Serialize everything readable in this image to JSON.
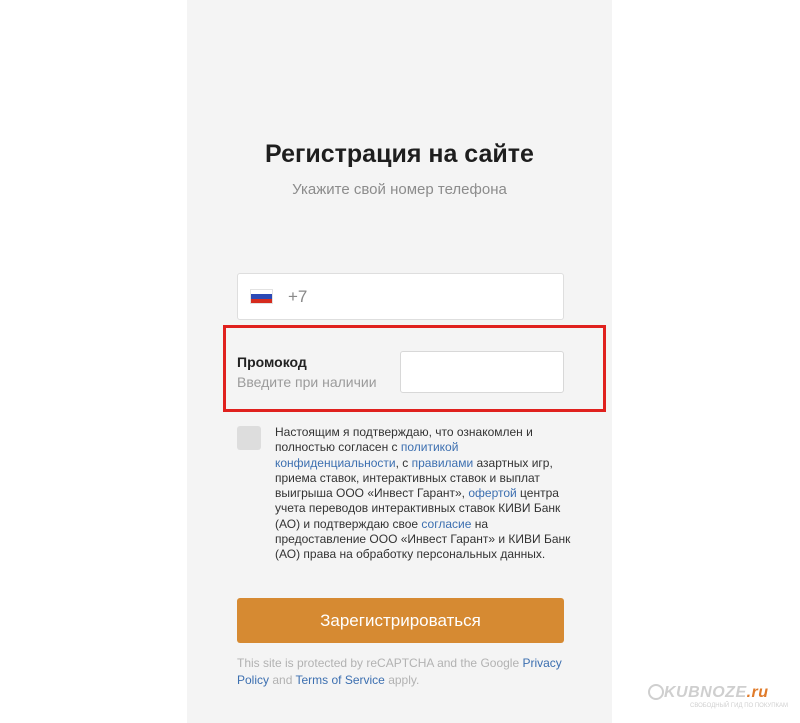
{
  "page": {
    "title": "Регистрация на сайте",
    "subtitle": "Укажите свой номер телефона"
  },
  "phone": {
    "flag": "russia-flag-icon",
    "prefix": "+7"
  },
  "promo": {
    "title": "Промокод",
    "hint": "Введите при наличии",
    "value": ""
  },
  "consent": {
    "text_1": "Настоящим я подтверждаю, что ознакомлен и полностью согласен с ",
    "link_privacy": "политикой конфиденциальности",
    "text_2": ", с ",
    "link_rules": "правилами",
    "text_3": " азартных игр, приема ставок, интерактивных ставок и выплат выигрыша ООО «Инвест Гарант», ",
    "link_offer": "офертой",
    "text_4": " центра учета переводов интерактивных ставок КИВИ Банк (АО) и подтверждаю свое ",
    "link_consent": "согласие",
    "text_5": " на предоставление ООО «Инвест Гарант» и КИВИ Банк (АО) права на обработку персональных данных."
  },
  "register_button": "Зарегистрироваться",
  "recaptcha": {
    "text_1": "This site is protected by reCAPTCHA and the Google ",
    "link_privacy": "Privacy Policy",
    "text_2": " and ",
    "link_terms": "Terms of Service",
    "text_3": " apply."
  },
  "watermark": {
    "name": "KUBNOZE",
    "tld": ".ru",
    "sub": "СВОБОДНЫЙ ГИД ПО ПОКУПКАМ"
  },
  "colors": {
    "accent": "#d68a32",
    "highlight_frame": "#e0211e",
    "link": "#3c6fb0"
  }
}
